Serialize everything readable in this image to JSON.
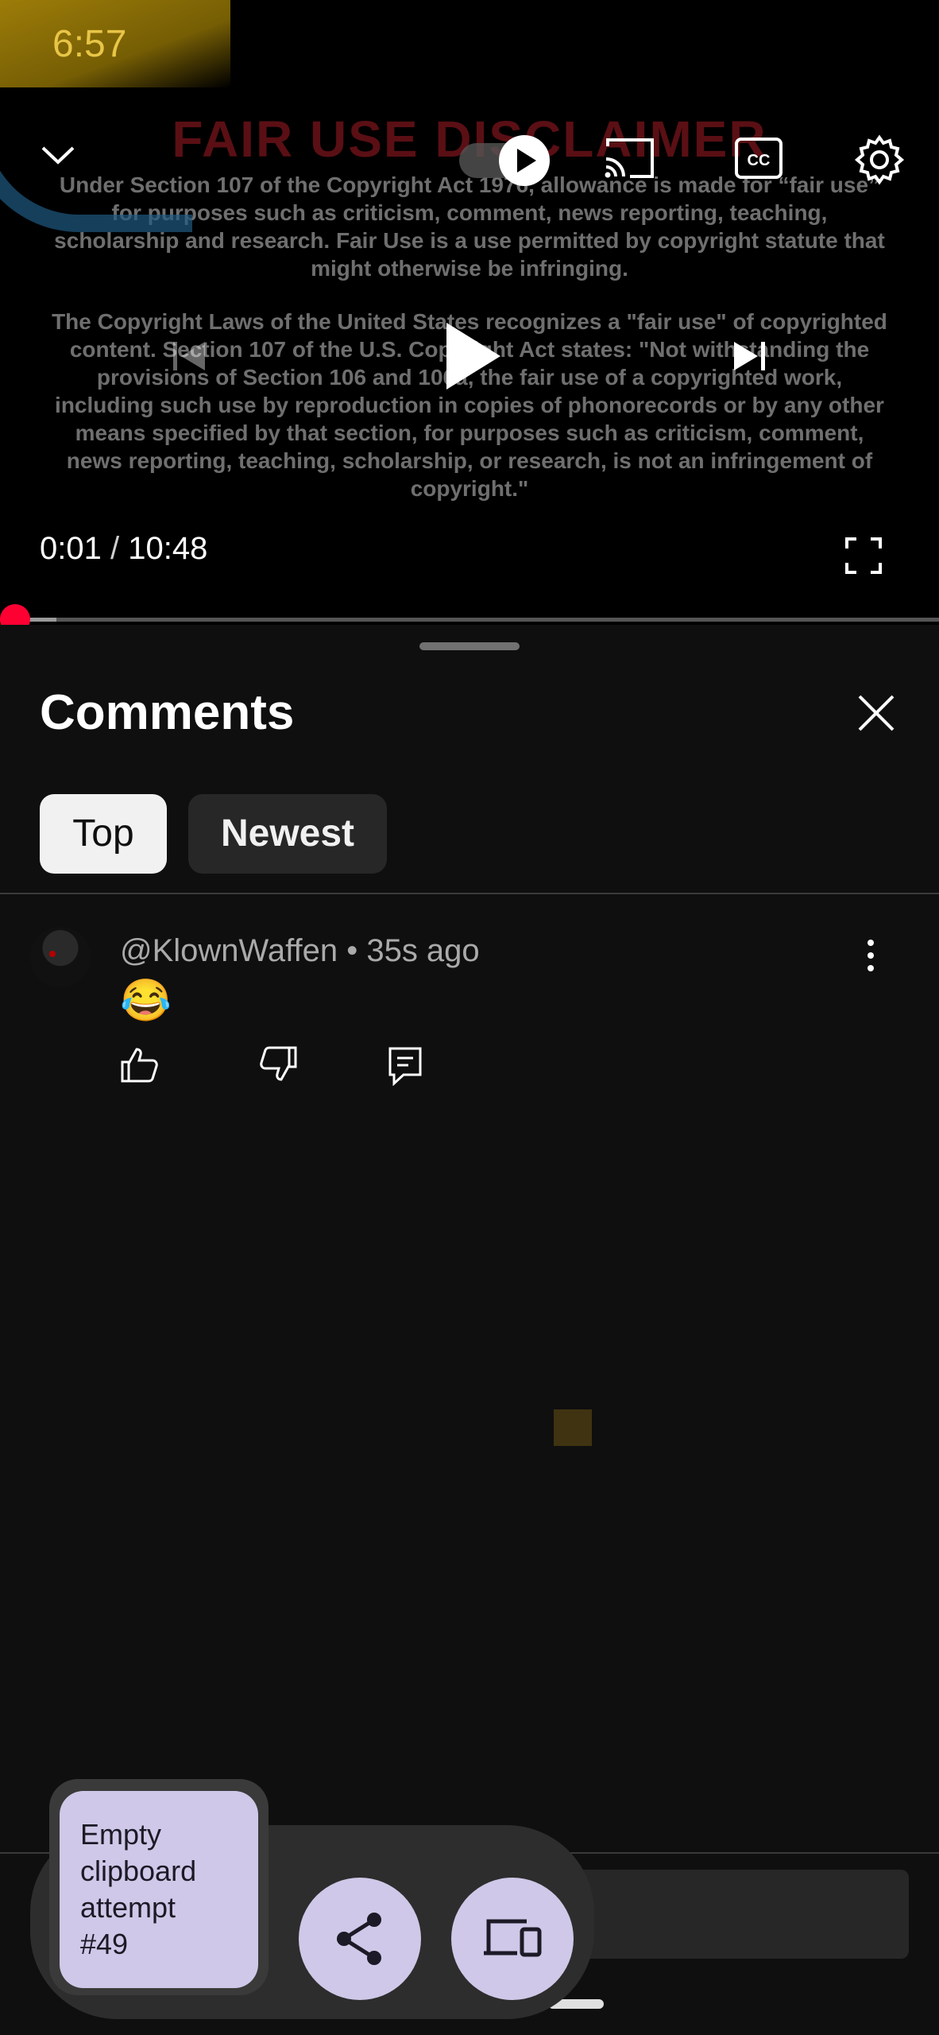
{
  "status_bar": {
    "time": "6:57"
  },
  "video": {
    "disclaimer_title": "FAIR USE DISCLAIMER",
    "disclaimer_paragraph_1": "Under Section 107 of the Copyright Act 1976, allowance is made for “fair use” for purposes such as criticism, comment, news reporting,  teaching, scholarship and research. Fair Use is a use permitted by copyright statute that might otherwise be infringing.",
    "disclaimer_paragraph_2": "The Copyright Laws of the United States recognizes a \"fair use\" of copyrighted content. Section 107 of the U.S. Copyright Act states: \"Not withstanding the provisions of Section 106 and 106a, the fair use of a copyrighted work, including such use by reproduction in copies of phonorecords or by any other means specified by that section, for purposes such as criticism, comment, news reporting, teaching, scholarship, or research, is not an infringement of copyright.\"",
    "current_time": "0:01",
    "separator": "/",
    "duration": "10:48",
    "progress_fraction": 0.0015,
    "buffered_fraction": 0.06,
    "accent_color": "#ff0033",
    "icons": {
      "collapse": "chevron-down-icon",
      "autoplay": "autoplay-toggle-icon",
      "cast": "cast-icon",
      "captions": "closed-captions-icon",
      "settings": "gear-icon",
      "previous": "previous-icon",
      "play": "play-icon",
      "next": "next-icon",
      "fullscreen": "fullscreen-icon"
    }
  },
  "comments_panel": {
    "title": "Comments",
    "close_icon": "close-icon",
    "sort_chips": [
      {
        "label": "Top",
        "selected": true
      },
      {
        "label": "Newest",
        "selected": false
      }
    ],
    "comments": [
      {
        "author": "@KlownWaffen",
        "dot": "•",
        "age": "35s ago",
        "text": "😂",
        "actions": [
          "like-icon",
          "dislike-icon",
          "reply-icon"
        ]
      }
    ]
  },
  "overlay": {
    "clipboard_lines": [
      "Empty",
      "clipboard",
      "attempt",
      "#49"
    ],
    "buttons": [
      "share-icon",
      "device-icon"
    ]
  }
}
